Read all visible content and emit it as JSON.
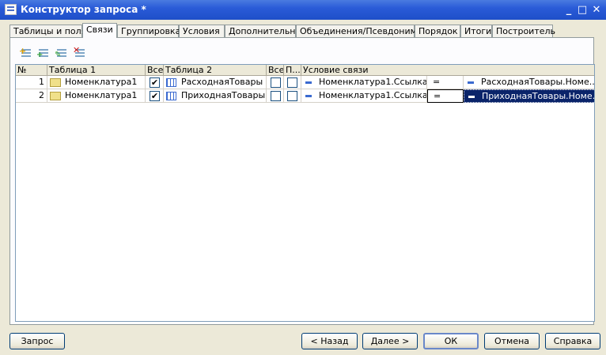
{
  "window": {
    "title": "Конструктор запроса *",
    "buttons": [
      "_",
      "□",
      "✕"
    ]
  },
  "tabs": [
    "Таблицы и поля",
    "Связи",
    "Группировка",
    "Условия",
    "Дополнительно",
    "Объединения/Псевдонимы",
    "Порядок",
    "Итоги",
    "Построитель"
  ],
  "active_tab": "Связи",
  "toolbar": {
    "icons": [
      "add-link-icon",
      "copy-link-icon",
      "edit-link-icon",
      "delete-link-icon"
    ]
  },
  "grid": {
    "columns": [
      "№",
      "Таблица 1",
      "Все",
      "Таблица 2",
      "Все",
      "П...",
      "Условие связи"
    ],
    "rows": [
      {
        "num": "1",
        "table1": "Номенклатура1",
        "all1": true,
        "table2": "РасходнаяТовары",
        "all2": false,
        "p": false,
        "left": "Номенклатура1.Ссылка",
        "op": "=",
        "right": "РасходнаяТовары.Номе..."
      },
      {
        "num": "2",
        "table1": "Номенклатура1",
        "all1": true,
        "table2": "ПриходнаяТовары",
        "all2": false,
        "p": false,
        "left": "Номенклатура1.Ссылка",
        "op": "=",
        "right": "ПриходнаяТовары.Номе..."
      }
    ]
  },
  "buttons": {
    "query": "Запрос",
    "back": "< Назад",
    "next": "Далее >",
    "ok": "ОК",
    "cancel": "Отмена",
    "help": "Справка"
  },
  "colors": {
    "titlebar": "#2a5bd8",
    "selection": "#0a246a",
    "dialog_bg": "#ece9d8"
  }
}
